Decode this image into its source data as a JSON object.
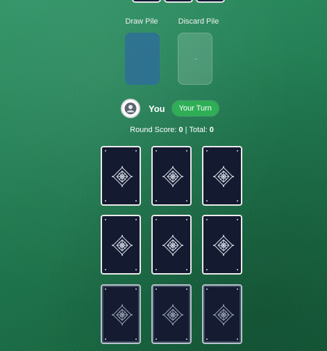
{
  "piles": {
    "draw_label": "Draw Pile",
    "discard_label": "Discard Pile"
  },
  "player": {
    "name": "You",
    "turn_status": "Your Turn",
    "avatar_icon": "user-icon"
  },
  "score": {
    "round_label": "Round Score:",
    "round_value": "0",
    "separator": "|",
    "total_label": "Total:",
    "total_value": "0"
  },
  "cards": [
    {
      "state": "face-down"
    },
    {
      "state": "face-down"
    },
    {
      "state": "face-down"
    },
    {
      "state": "face-down"
    },
    {
      "state": "face-down"
    },
    {
      "state": "face-down"
    },
    {
      "state": "face-down-dim"
    },
    {
      "state": "face-down-dim"
    },
    {
      "state": "face-down-dim"
    }
  ],
  "colors": {
    "table": "#1f7a50",
    "draw_pile": "#2e6e98",
    "turn_badge": "#2eaf56",
    "card_back": "#141a30"
  }
}
